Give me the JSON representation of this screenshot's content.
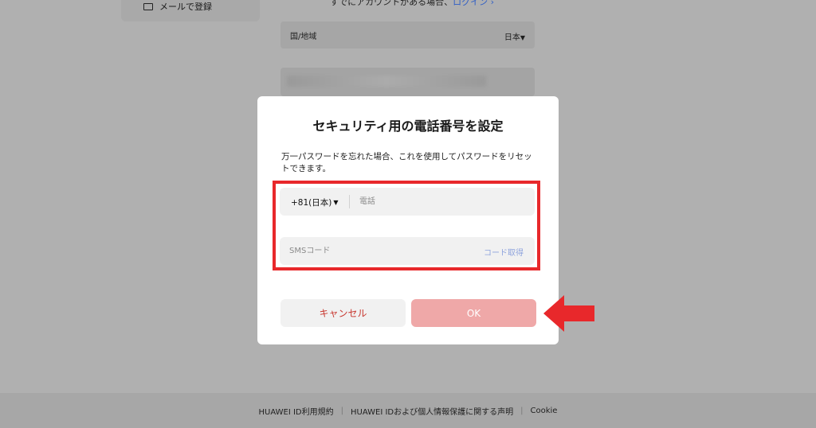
{
  "background": {
    "email_signup_label": "メールで登録",
    "login_prompt": "すでにアカウントがある場合、",
    "login_link": "ログイン",
    "region_label": "国/地域",
    "region_value": "日本"
  },
  "modal": {
    "title": "セキュリティ用の電話番号を設定",
    "description": "万一パスワードを忘れた場合、これを使用してパスワードをリセットできます。",
    "country_code": "+81(日本)",
    "phone_placeholder": "電話",
    "sms_placeholder": "SMSコード",
    "get_code_label": "コード取得",
    "cancel_label": "キャンセル",
    "ok_label": "OK"
  },
  "footer": {
    "links": [
      "HUAWEI ID利用規約",
      "HUAWEI IDおよび個人情報保護に関する声明",
      "Cookie"
    ]
  },
  "colors": {
    "accent_red": "#e8282b",
    "ok_disabled": "#efa8a8",
    "cancel_text": "#c8372f",
    "link_blue": "#8ea3dd"
  }
}
